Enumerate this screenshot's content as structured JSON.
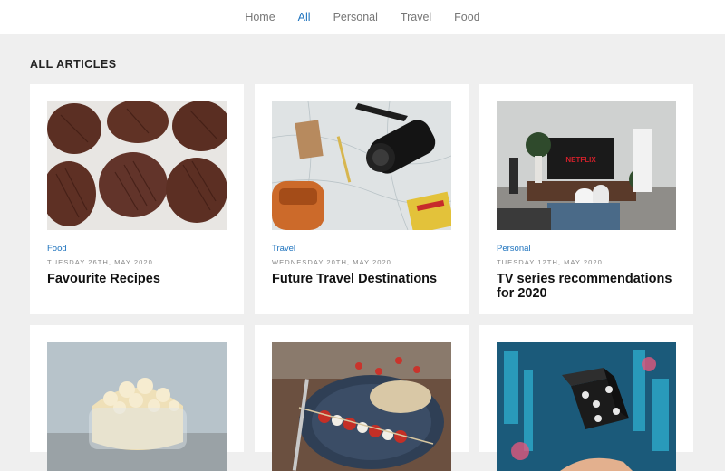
{
  "nav": {
    "items": [
      {
        "label": "Home"
      },
      {
        "label": "All"
      },
      {
        "label": "Personal"
      },
      {
        "label": "Travel"
      },
      {
        "label": "Food"
      }
    ],
    "active": "All"
  },
  "section": {
    "title": "ALL ARTICLES"
  },
  "articles": [
    {
      "category": "Food",
      "date": "TUESDAY 26TH, MAY 2020",
      "title": "Favourite Recipes",
      "image": "cookies-photo"
    },
    {
      "category": "Travel",
      "date": "WEDNESDAY 20TH, MAY 2020",
      "title": "Future Travel Destinations",
      "image": "map-camera-photo"
    },
    {
      "category": "Personal",
      "date": "TUESDAY 12TH, MAY 2020",
      "title": "TV series recommendations for 2020",
      "image": "tv-livingroom-photo",
      "tv_brand": "NETFLIX"
    },
    {
      "category": "",
      "date": "",
      "title": "",
      "image": "popcorn-photo"
    },
    {
      "category": "",
      "date": "",
      "title": "",
      "image": "skewers-photo"
    },
    {
      "category": "",
      "date": "",
      "title": "",
      "image": "dice-photo"
    }
  ],
  "colors": {
    "accent": "#1e73be",
    "background": "#efefef",
    "card": "#ffffff"
  }
}
